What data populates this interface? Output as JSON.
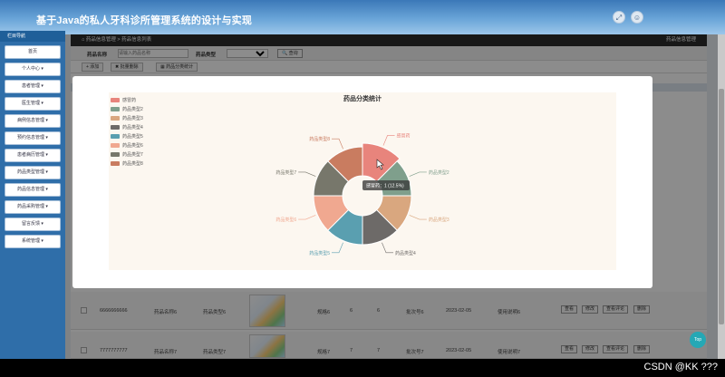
{
  "header": {
    "title": "基于Java的私人牙科诊所管理系统的设计与实现",
    "icons": [
      "expand-icon",
      "user-icon"
    ]
  },
  "sidebar": {
    "title": "栏目导航",
    "items": [
      "首页",
      "个人中心 ▾",
      "患者管理 ▾",
      "医生管理 ▾",
      "病例信息管理 ▾",
      "预约信息管理 ▾",
      "患者病历管理 ▾",
      "药品类型管理 ▾",
      "药品信息管理 ▾",
      "药品采购管理 ▾",
      "留言反馈 ▾",
      "系统管理 ▾"
    ]
  },
  "breadcrumb": {
    "path": "药品信息管理 > 药品信息列表",
    "current": "药品信息管理"
  },
  "search": {
    "name_label": "药品名称",
    "name_placeholder": "请输入药品名称",
    "type_label": "药品类型",
    "button": "查询"
  },
  "toolbar": {
    "add": "+ 添加",
    "batch_delete": "✖ 批量删除",
    "stats": "▦ 药品分类统计"
  },
  "rows": [
    {
      "code": "6666666666",
      "name": "药品名称6",
      "type": "药品类型6",
      "spec": "规格6",
      "a": "6",
      "b": "6",
      "batch": "批次号6",
      "date": "2023-02-05",
      "desc": "使用说明6",
      "view": "查看",
      "edit": "修改",
      "review": "查看评论",
      "del": "删除"
    },
    {
      "code": "7777777777",
      "name": "药品名称7",
      "type": "药品类型7",
      "spec": "规格7",
      "a": "7",
      "b": "7",
      "batch": "批次号7",
      "date": "2023-02-05",
      "desc": "使用说明7",
      "view": "查看",
      "edit": "修改",
      "review": "查看评论",
      "del": "删除"
    }
  ],
  "chart_data": {
    "type": "pie",
    "title": "药品分类统计",
    "categories": [
      "感冒药",
      "药品类型2",
      "药品类型3",
      "药品类型4",
      "药品类型5",
      "药品类型6",
      "药品类型7",
      "药品类型8"
    ],
    "values": [
      1,
      1,
      1,
      1,
      1,
      1,
      1,
      1
    ],
    "colors": [
      "#e8847c",
      "#7f9f8c",
      "#d9a77f",
      "#6d6a68",
      "#5a9fb0",
      "#f0a890",
      "#77776b",
      "#c97c60"
    ],
    "donut": true,
    "legend_position": "top-left",
    "tooltip": "感冒药：1 (12.5%)"
  },
  "misc": {
    "top_button": "Top",
    "watermark": "CSDN @KK ???"
  }
}
